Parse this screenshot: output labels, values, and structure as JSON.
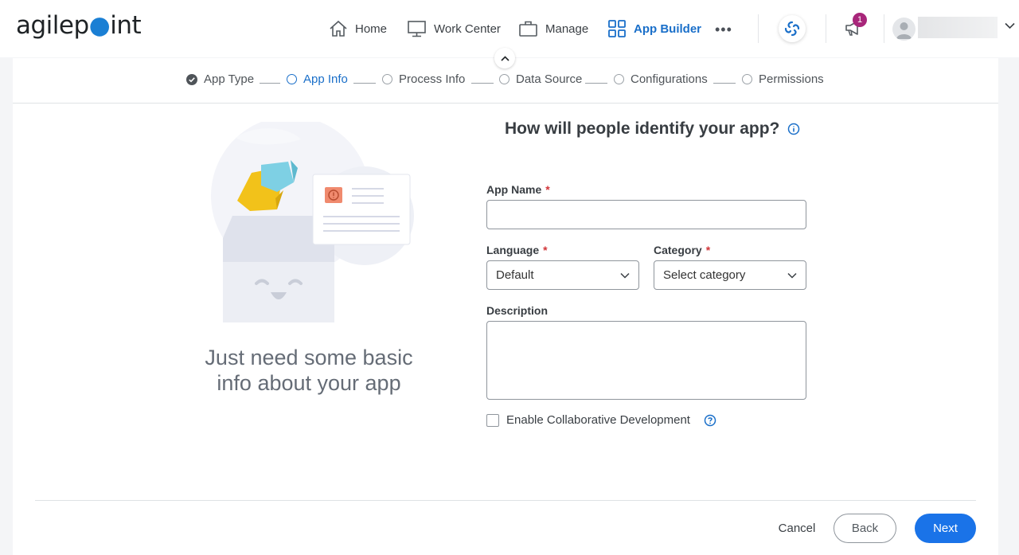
{
  "header": {
    "logo_text_pre": "agilep",
    "logo_text_post": "int",
    "nav": [
      {
        "label": "Home",
        "icon": "home-icon"
      },
      {
        "label": "Work Center",
        "icon": "monitor-icon"
      },
      {
        "label": "Manage",
        "icon": "briefcase-icon"
      },
      {
        "label": "App Builder",
        "icon": "grid-icon"
      }
    ],
    "more_label": "•••",
    "notification_count": "1",
    "colors": {
      "accent": "#1a6fc9",
      "badge": "#a8267a",
      "primary_button": "#1a73e8"
    }
  },
  "stepper": {
    "steps": [
      {
        "label": "App Type",
        "state": "done"
      },
      {
        "label": "App Info",
        "state": "current"
      },
      {
        "label": "Process Info",
        "state": "pending"
      },
      {
        "label": "Data Source",
        "state": "pending"
      },
      {
        "label": "Configurations",
        "state": "pending"
      },
      {
        "label": "Permissions",
        "state": "pending"
      }
    ]
  },
  "left_panel": {
    "tagline": "Just need some basic info about your app"
  },
  "form": {
    "title": "How will people identify your app?",
    "app_name": {
      "label": "App Name",
      "required": "*",
      "value": "",
      "placeholder": ""
    },
    "language": {
      "label": "Language",
      "required": "*",
      "value": "Default"
    },
    "category": {
      "label": "Category",
      "required": "*",
      "value": "Select category"
    },
    "description": {
      "label": "Description",
      "value": ""
    },
    "collaborative": {
      "label": "Enable Collaborative Development",
      "checked": false
    }
  },
  "footer": {
    "cancel_label": "Cancel",
    "back_label": "Back",
    "next_label": "Next"
  }
}
